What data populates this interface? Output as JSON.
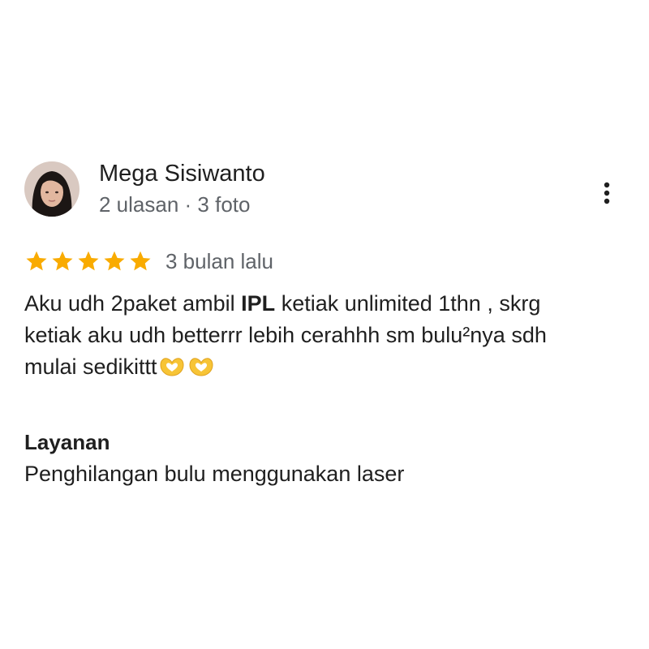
{
  "reviewer": {
    "name": "Mega Sisiwanto",
    "meta": "2 ulasan · 3 foto",
    "avatar_icon": "reviewer-profile-photo"
  },
  "menu": {
    "icon": "more-vertical-icon"
  },
  "rating": {
    "stars": 5,
    "max_stars": 5,
    "star_color": "#f9ab00",
    "date": "3 bulan lalu"
  },
  "review": {
    "line1_pre": "Aku udh 2paket ambil ",
    "line1_bold": "IPL",
    "line1_post": " ketiak unlimited 1thn , skrg",
    "line2": "ketiak aku udh betterrr lebih cerahhh sm bulu²nya sdh",
    "line3": "mulai sedikittt",
    "emojis": [
      "heart-hands-emoji",
      "heart-hands-emoji"
    ]
  },
  "service": {
    "label": "Layanan",
    "value": "Penghilangan bulu menggunakan laser"
  }
}
